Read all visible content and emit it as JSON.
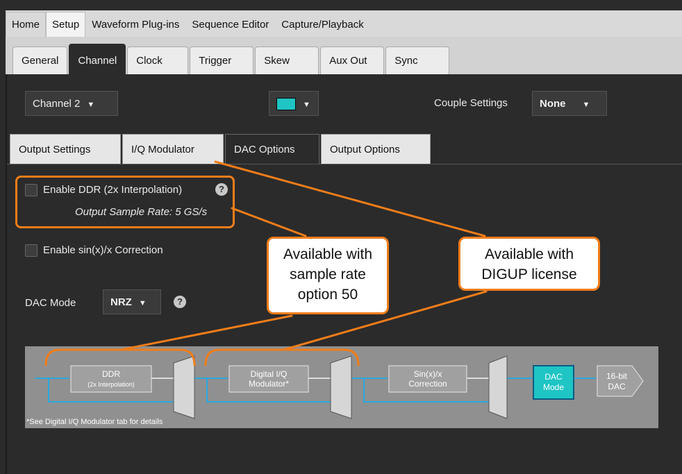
{
  "menu": {
    "tabs": [
      "Home",
      "Setup",
      "Waveform Plug-ins",
      "Sequence Editor",
      "Capture/Playback"
    ]
  },
  "setup_tabs": [
    "General",
    "Channel",
    "Clock",
    "Trigger",
    "Skew",
    "Aux Out",
    "Sync"
  ],
  "channel": {
    "selected": "Channel 2",
    "color": "#1ec5c4"
  },
  "couple": {
    "label": "Couple Settings",
    "value": "None"
  },
  "inner_tabs": [
    "Output Settings",
    "I/Q Modulator",
    "DAC Options",
    "Output Options"
  ],
  "ddr": {
    "label": "Enable DDR (2x Interpolation)",
    "help": "?",
    "rate": "Output Sample Rate: 5 GS/s"
  },
  "sinx": {
    "label": "Enable sin(x)/x Correction"
  },
  "dac_mode": {
    "label": "DAC Mode",
    "value": "NRZ",
    "help": "?"
  },
  "callouts": {
    "sample_rate": [
      "Available with",
      "sample rate",
      "option 50"
    ],
    "digup": [
      "Available with",
      "DIGUP license"
    ]
  },
  "diagram": {
    "ddr_block": [
      "DDR",
      "(2x Interpolation)"
    ],
    "iq_block": [
      "Digital I/Q",
      "Modulator*"
    ],
    "sinx_block": [
      "Sin(x)/x",
      "Correction"
    ],
    "dac_mode_block": [
      "DAC",
      "Mode"
    ],
    "dac_block": [
      "16-bit",
      "DAC"
    ],
    "footnote": "*See Digital I/Q Modulator tab for details"
  },
  "colors": {
    "accent": "#f07d1a",
    "dac_highlight": "#1ec5c4",
    "flow": "#29a8e0"
  }
}
